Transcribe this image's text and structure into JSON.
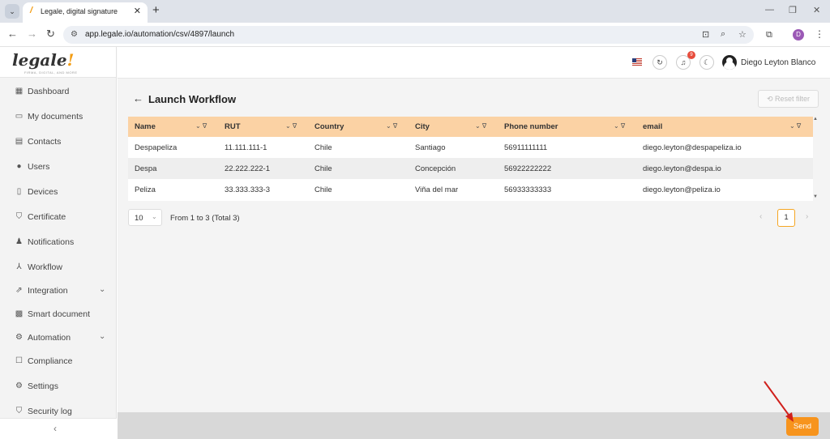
{
  "browser": {
    "tab_title": "Legale, digital signature",
    "url": "app.legale.io/automation/csv/4897/launch",
    "profile_initial": "D"
  },
  "logo": {
    "text": "legale",
    "bang": "!",
    "tagline": "FIRMA, DIGITAL, AND MORE"
  },
  "sidebar": {
    "items": [
      {
        "label": "Dashboard",
        "icon": "dashboard-icon"
      },
      {
        "label": "My documents",
        "icon": "folder-icon"
      },
      {
        "label": "Contacts",
        "icon": "contacts-icon"
      },
      {
        "label": "Users",
        "icon": "user-icon"
      },
      {
        "label": "Devices",
        "icon": "device-icon"
      },
      {
        "label": "Certificate",
        "icon": "shield-check-icon"
      },
      {
        "label": "Notifications",
        "icon": "bell-icon"
      },
      {
        "label": "Workflow",
        "icon": "workflow-icon"
      },
      {
        "label": "Integration",
        "icon": "external-link-icon"
      },
      {
        "label": "Smart document",
        "icon": "smart-document-icon"
      },
      {
        "label": "Automation",
        "icon": "automation-gear-icon"
      },
      {
        "label": "Compliance",
        "icon": "compliance-icon"
      },
      {
        "label": "Settings",
        "icon": "gear-icon"
      },
      {
        "label": "Security log",
        "icon": "shield-icon"
      }
    ]
  },
  "header": {
    "notification_count": "9",
    "user_name": "Diego Leyton Blanco"
  },
  "page": {
    "title": "Launch Workflow",
    "reset_filter_label": "Reset filter"
  },
  "table": {
    "columns": [
      "Name",
      "RUT",
      "Country",
      "City",
      "Phone number",
      "email"
    ],
    "rows": [
      [
        "Despapeliza",
        "11.111.111-1",
        "Chile",
        "Santiago",
        "56911111111",
        "diego.leyton@despapeliza.io"
      ],
      [
        "Despa",
        "22.222.222-1",
        "Chile",
        "Concepción",
        "56922222222",
        "diego.leyton@despa.io"
      ],
      [
        "Peliza",
        "33.333.333-3",
        "Chile",
        "Viña del mar",
        "56933333333",
        "diego.leyton@peliza.io"
      ]
    ]
  },
  "pagination": {
    "page_size": "10",
    "info": "From 1 to 3 (Total 3)",
    "current_page": "1"
  },
  "footer": {
    "send_label": "Send"
  },
  "colors": {
    "accent": "#f7941d",
    "table_header": "#fbd2a4",
    "badge": "#e74c3c"
  }
}
